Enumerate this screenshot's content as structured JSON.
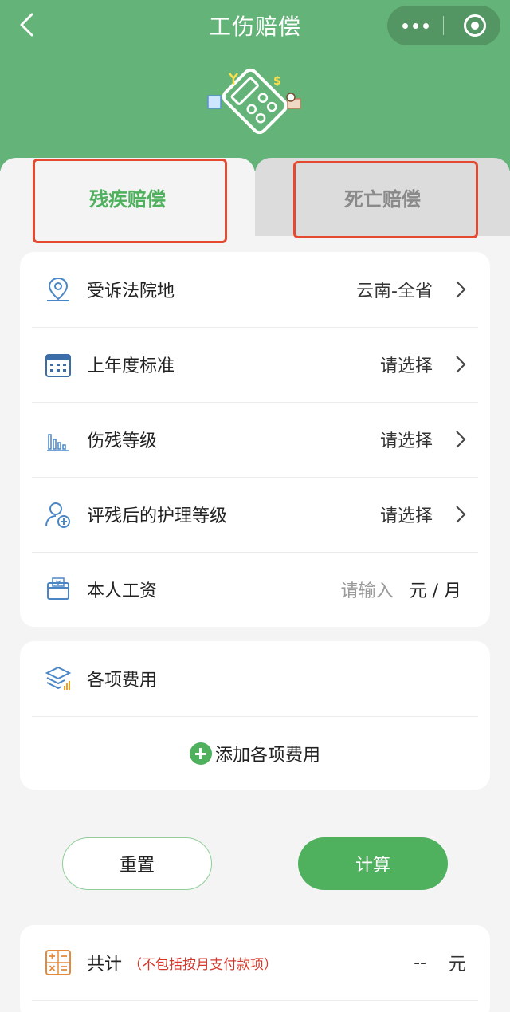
{
  "header": {
    "title": "工伤赔偿",
    "bg_color": "#64b378"
  },
  "tabs": [
    {
      "label": "残疾赔偿",
      "active": true
    },
    {
      "label": "死亡赔偿",
      "active": false
    }
  ],
  "form": {
    "rows": [
      {
        "label": "受诉法院地",
        "value": "云南-全省",
        "icon": "location-pin-icon"
      },
      {
        "label": "上年度标准",
        "value": "请选择",
        "icon": "calendar-icon"
      },
      {
        "label": "伤残等级",
        "value": "请选择",
        "icon": "bar-chart-icon"
      },
      {
        "label": "评残后的护理等级",
        "value": "请选择",
        "icon": "nurse-user-icon"
      }
    ],
    "salary": {
      "label": "本人工资",
      "placeholder": "请输入",
      "unit": "元 / 月",
      "icon": "wallet-icon"
    }
  },
  "expenses": {
    "label": "各项费用",
    "add_label": "添加各项费用",
    "icon": "layers-icon"
  },
  "buttons": {
    "reset": "重置",
    "calculate": "计算"
  },
  "total": {
    "label": "共计",
    "note": "（不包括按月支付款项）",
    "value": "--",
    "unit": "元"
  },
  "colors": {
    "accent": "#4fb05e",
    "highlight": "#e5492f"
  }
}
